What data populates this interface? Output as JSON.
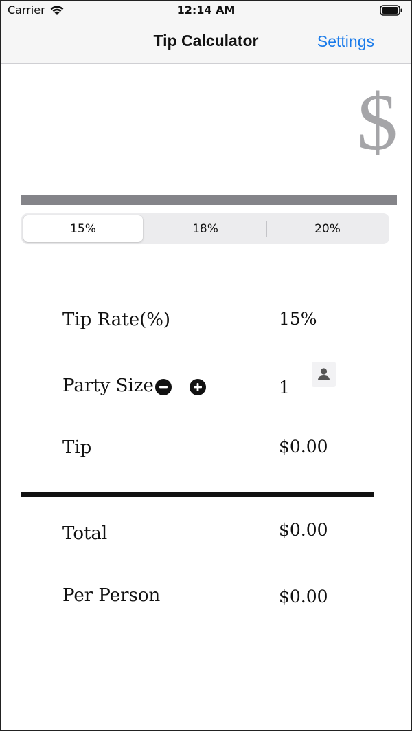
{
  "status_bar": {
    "carrier": "Carrier",
    "time": "12:14 AM"
  },
  "nav": {
    "title": "Tip Calculator",
    "settings_label": "Settings"
  },
  "display": {
    "currency_symbol": "$"
  },
  "tip_selector": {
    "options": [
      "15%",
      "18%",
      "20%"
    ],
    "selected_index": 0
  },
  "rows": {
    "tip_rate": {
      "label": "Tip Rate(%)",
      "value": "15%"
    },
    "party_size": {
      "label": "Party Size",
      "value": "1"
    },
    "tip": {
      "label": "Tip",
      "value": "$0.00"
    },
    "total": {
      "label": "Total",
      "value": "$0.00"
    },
    "per_person": {
      "label": "Per Person",
      "value": "$0.00"
    }
  },
  "colors": {
    "accent": "#1a7bea",
    "bar": "#848489",
    "symbol": "#a5a5a8"
  }
}
